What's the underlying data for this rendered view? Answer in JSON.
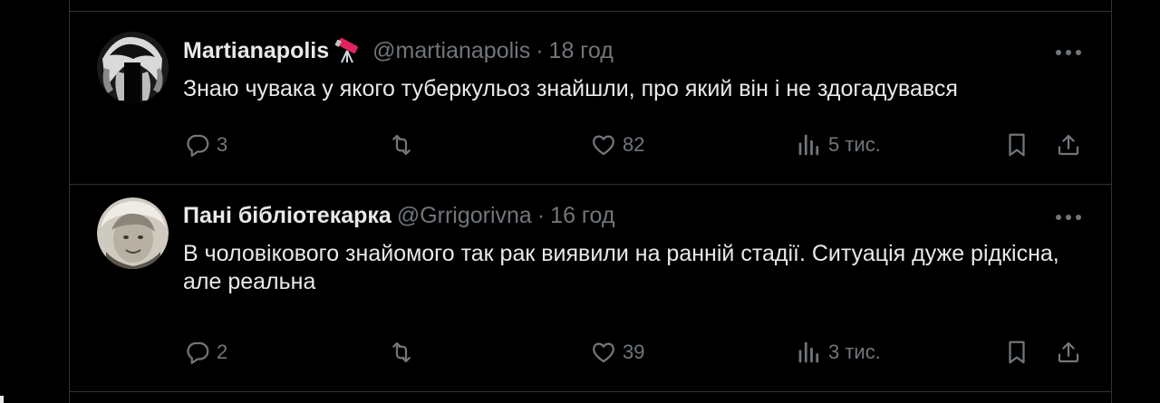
{
  "colors": {
    "background": "#000000",
    "text": "#e7e9ea",
    "muted": "#71767b",
    "border": "#2f3336"
  },
  "tweets": [
    {
      "display_name": "Martianapolis",
      "badge_icon": "telescope-icon",
      "handle": "@martianapolis",
      "separator": "·",
      "time": "18 год",
      "text": "Знаю чувака у якого туберкульоз знайшли, про який він і не здогадувався",
      "actions": {
        "replies": "3",
        "reposts": "",
        "likes": "82",
        "views": "5 тис."
      }
    },
    {
      "display_name": "Пані бібліотекарка",
      "handle": "@Grrigorivna",
      "separator": "·",
      "time": "16 год",
      "text": "В чоловікового знайомого так рак виявили на ранній стадії. Ситуація дуже рідкісна, але реальна",
      "actions": {
        "replies": "2",
        "reposts": "",
        "likes": "39",
        "views": "3 тис."
      }
    }
  ]
}
